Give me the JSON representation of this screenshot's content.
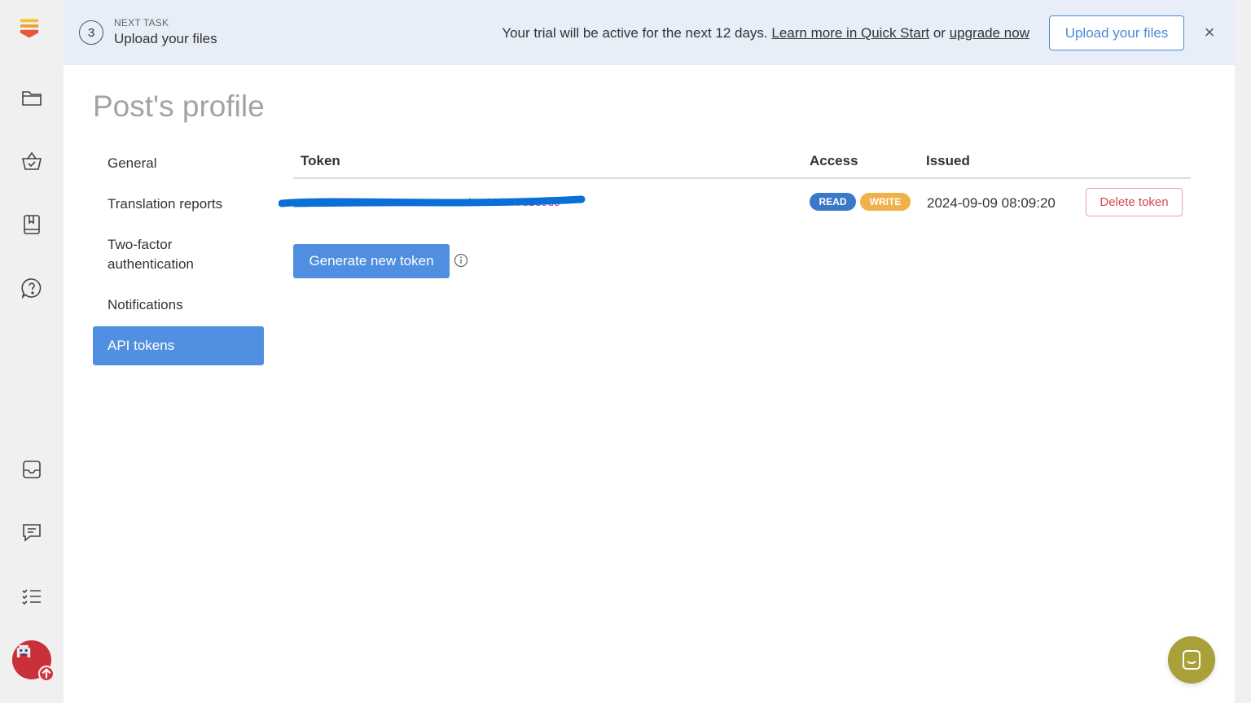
{
  "banner": {
    "step_number": "3",
    "next_label": "NEXT TASK",
    "next_title": "Upload your files",
    "trial_prefix": "Your trial will be active for the next 12 days.",
    "learn_more": "Learn more in Quick Start",
    "or_text": "or",
    "upgrade": "upgrade now",
    "upload_button": "Upload your files",
    "close": "×"
  },
  "page": {
    "title": "Post's profile"
  },
  "nav": {
    "items": [
      {
        "label": "General"
      },
      {
        "label": "Translation reports"
      },
      {
        "label": "Two-factor authentication"
      },
      {
        "label": "Notifications"
      },
      {
        "label": "API tokens",
        "active": true
      }
    ]
  },
  "table": {
    "headers": {
      "token": "Token",
      "access": "Access",
      "issued": "Issued"
    },
    "rows": [
      {
        "token": "••••••••••••••••••••••••ssd2.d2d77fd2d9d5",
        "access": [
          "READ",
          "WRITE"
        ],
        "issued": "2024-09-09 08:09:20",
        "delete_label": "Delete token"
      }
    ]
  },
  "actions": {
    "generate": "Generate new token"
  },
  "icons": {
    "rail": [
      "logo-icon",
      "folder-icon",
      "basket-icon",
      "book-icon",
      "help-icon",
      "inbox-icon",
      "chat-icon",
      "checklist-icon"
    ],
    "info": "info-icon",
    "chat_bubble": "chat-bubble-icon"
  },
  "colors": {
    "accent": "#5190e1",
    "read": "#3a78c9",
    "write": "#f0b04a",
    "danger": "#d64550",
    "chat": "#a9a039"
  }
}
